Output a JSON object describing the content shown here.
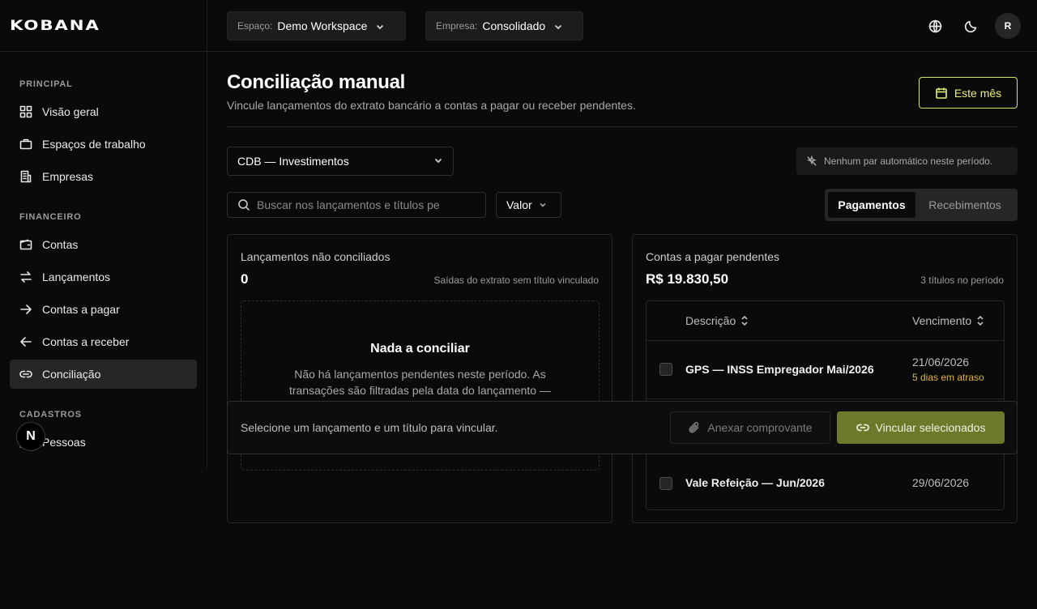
{
  "brand": {
    "logo": "KOBANA"
  },
  "topbar": {
    "workspace": {
      "label": "Espaço:",
      "value": "Demo Workspace"
    },
    "company": {
      "label": "Empresa:",
      "value": "Consolidado"
    },
    "avatar_initial": "R"
  },
  "sidebar": {
    "sections": [
      {
        "title": "PRINCIPAL"
      },
      {
        "title": "FINANCEIRO"
      },
      {
        "title": "CADASTROS"
      }
    ],
    "items": [
      {
        "label": "Visão geral",
        "icon": "dashboard-icon"
      },
      {
        "label": "Espaços de trabalho",
        "icon": "briefcase-icon"
      },
      {
        "label": "Empresas",
        "icon": "building-icon"
      },
      {
        "label": "Contas",
        "icon": "wallet-icon"
      },
      {
        "label": "Lançamentos",
        "icon": "arrows-exchange-icon"
      },
      {
        "label": "Contas a pagar",
        "icon": "arrow-right-icon"
      },
      {
        "label": "Contas a receber",
        "icon": "arrow-left-icon"
      },
      {
        "label": "Conciliação",
        "icon": "link-icon",
        "active": true
      },
      {
        "label": "Pessoas",
        "icon": "users-icon"
      }
    ],
    "badge": "N"
  },
  "header": {
    "title": "Conciliação manual",
    "subtitle": "Vincule lançamentos do extrato bancário a contas a pagar ou receber pendentes.",
    "period_button": "Este mês"
  },
  "filters": {
    "account": "CDB — Investimentos",
    "auto_note": "Nenhum par automático neste período.",
    "search_placeholder": "Buscar nos lançamentos e títulos pe",
    "value_filter": "Valor",
    "tabs": [
      {
        "label": "Pagamentos",
        "active": true
      },
      {
        "label": "Recebimentos",
        "active": false
      }
    ]
  },
  "left_panel": {
    "title": "Lançamentos não conciliados",
    "count": "0",
    "meta": "Saídas do extrato sem título vinculado",
    "empty_title": "Nada a conciliar",
    "empty_text": "Não há lançamentos pendentes neste período. As transações são filtradas pela data do lançamento —"
  },
  "right_panel": {
    "title": "Contas a pagar pendentes",
    "total": "R$ 19.830,50",
    "meta": "3 títulos no período",
    "columns": {
      "description": "Descrição",
      "due": "Vencimento"
    },
    "rows": [
      {
        "description": "GPS — INSS Empregador Mai/2026",
        "due": "21/06/2026",
        "status": "5 dias em atraso"
      },
      {
        "description": "Vale Refeição — Jun/2026",
        "due": "29/06/2026",
        "status": ""
      }
    ]
  },
  "action_bar": {
    "hint": "Selecione um lançamento e um título para vincular.",
    "attach_label": "Anexar comprovante",
    "link_label": "Vincular selecionados"
  }
}
